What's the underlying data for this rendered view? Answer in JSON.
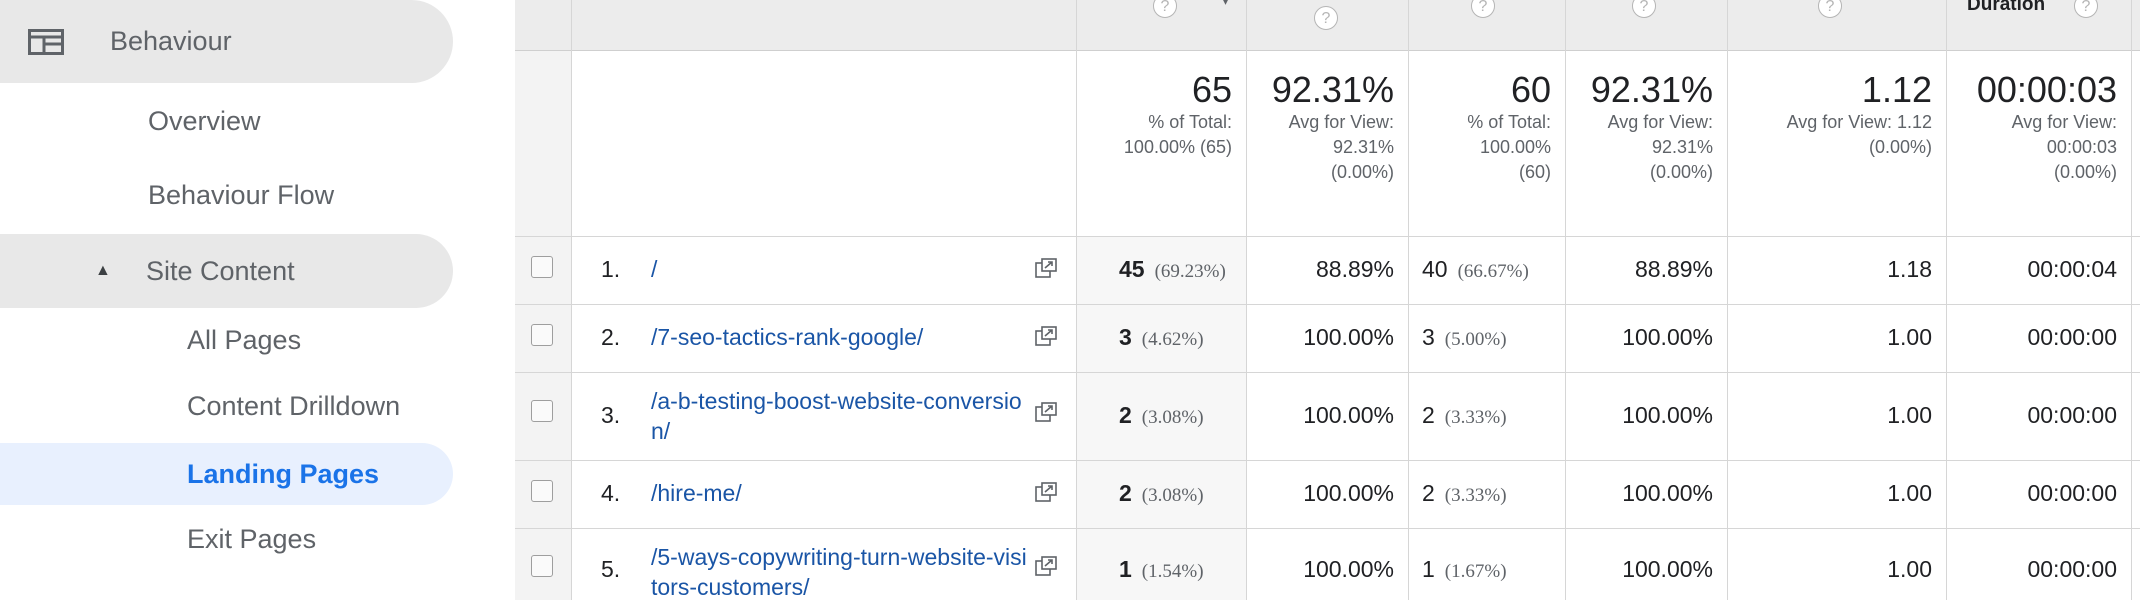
{
  "sidebar": {
    "behaviour": "Behaviour",
    "overview": "Overview",
    "behaviour_flow": "Behaviour Flow",
    "site_content": "Site Content",
    "all_pages": "All Pages",
    "content_drilldown": "Content Drilldown",
    "landing_pages": "Landing Pages",
    "exit_pages": "Exit Pages"
  },
  "table": {
    "duration_header": "Duration",
    "summary": [
      {
        "value": "65",
        "sub": "% of Total:\n100.00% (65)"
      },
      {
        "value": "92.31%",
        "sub": "Avg for View:\n92.31%\n(0.00%)"
      },
      {
        "value": "60",
        "sub": "% of Total:\n100.00%\n(60)"
      },
      {
        "value": "92.31%",
        "sub": "Avg for View:\n92.31%\n(0.00%)"
      },
      {
        "value": "1.12",
        "sub": "Avg for View: 1.12\n(0.00%)"
      },
      {
        "value": "00:00:03",
        "sub": "Avg for View:\n00:00:03\n(0.00%)"
      }
    ],
    "rows": [
      {
        "index": "1.",
        "page": "/",
        "sessions": "45",
        "sessions_pct": "(69.23%)",
        "pct_new": "88.89%",
        "new_users": "40",
        "new_users_pct": "(66.67%)",
        "bounce": "88.89%",
        "pages_per": "1.18",
        "duration": "00:00:04"
      },
      {
        "index": "2.",
        "page": "/7-seo-tactics-rank-google/",
        "sessions": "3",
        "sessions_pct": "(4.62%)",
        "pct_new": "100.00%",
        "new_users": "3",
        "new_users_pct": "(5.00%)",
        "bounce": "100.00%",
        "pages_per": "1.00",
        "duration": "00:00:00"
      },
      {
        "index": "3.",
        "page": "/a-b-testing-boost-website-conversion/",
        "sessions": "2",
        "sessions_pct": "(3.08%)",
        "pct_new": "100.00%",
        "new_users": "2",
        "new_users_pct": "(3.33%)",
        "bounce": "100.00%",
        "pages_per": "1.00",
        "duration": "00:00:00"
      },
      {
        "index": "4.",
        "page": "/hire-me/",
        "sessions": "2",
        "sessions_pct": "(3.08%)",
        "pct_new": "100.00%",
        "new_users": "2",
        "new_users_pct": "(3.33%)",
        "bounce": "100.00%",
        "pages_per": "1.00",
        "duration": "00:00:00"
      },
      {
        "index": "5.",
        "page": "/5-ways-copywriting-turn-website-visitors-customers/",
        "sessions": "1",
        "sessions_pct": "(1.54%)",
        "pct_new": "100.00%",
        "new_users": "1",
        "new_users_pct": "(1.67%)",
        "bounce": "100.00%",
        "pages_per": "1.00",
        "duration": "00:00:00"
      }
    ]
  },
  "icons": {
    "behaviour": "behaviour-icon",
    "expand": "triangle-up-icon",
    "help": "question-icon",
    "external": "external-link-icon",
    "checkbox": "checkbox-icon"
  },
  "colors": {
    "link": "#1a55a6",
    "active_nav_bg": "#e8f0fe",
    "active_nav_text": "#1a73e8"
  }
}
